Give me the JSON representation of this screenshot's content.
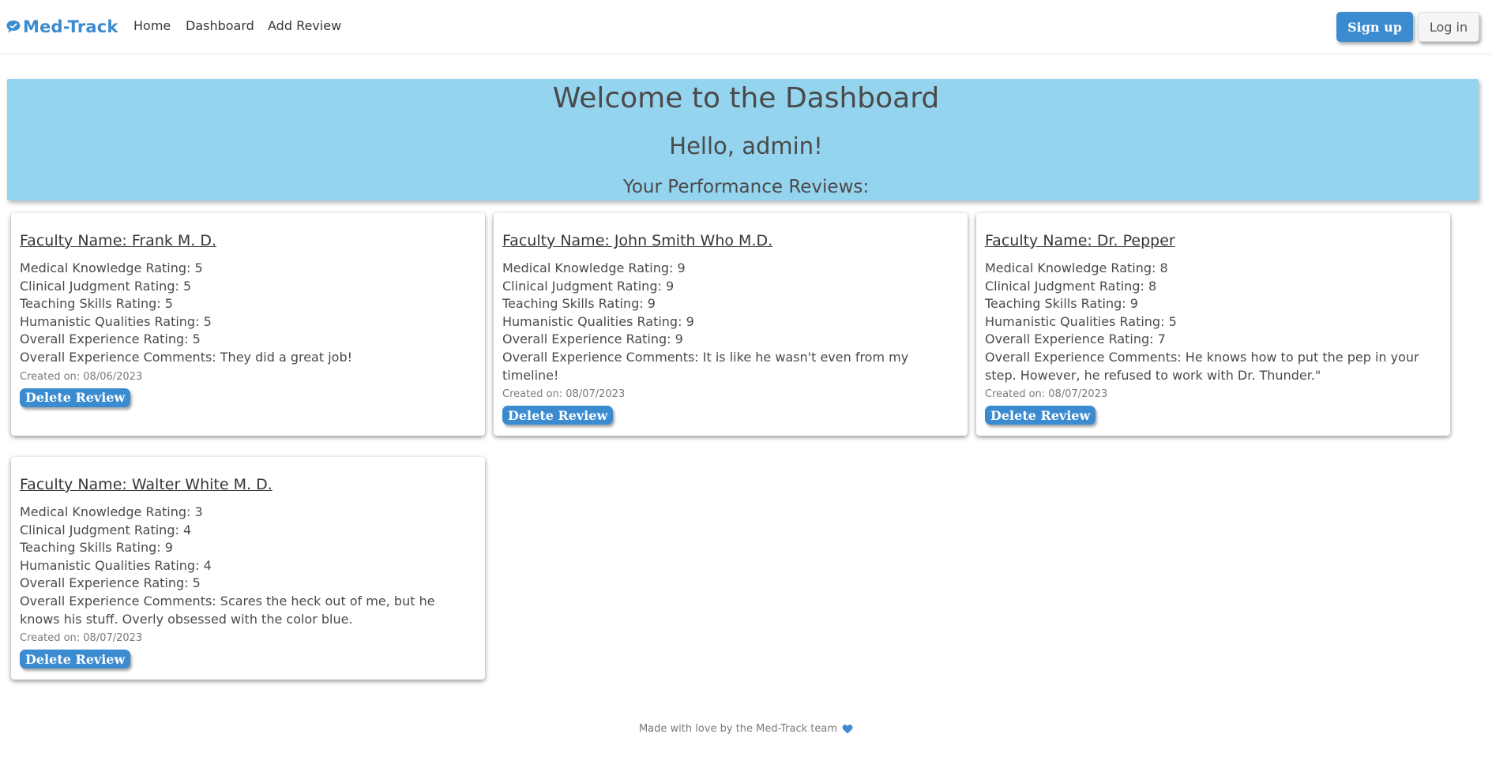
{
  "nav": {
    "brand": "Med-Track",
    "links": [
      "Home",
      "Dashboard",
      "Add Review"
    ],
    "signup_label": "Sign up",
    "login_label": "Log in",
    "brand_color": "#3b8bd0"
  },
  "hero": {
    "title": "Welcome to the Dashboard",
    "greeting": "Hello, admin!",
    "subtitle": "Your Performance Reviews:",
    "background": "#95d4ef"
  },
  "reviews": [
    {
      "faculty": "Faculty Name: Frank M. D.",
      "medical_knowledge": "Medical Knowledge Rating: 5",
      "clinical_judgment": "Clinical Judgment Rating: 5",
      "teaching_skills": "Teaching Skills Rating: 5",
      "humanistic_qualities": "Humanistic Qualities Rating: 5",
      "overall_rating": "Overall Experience Rating: 5",
      "comments": "Overall Experience Comments: They did a great job!",
      "created": "Created on: 08/06/2023",
      "delete_label": "Delete Review"
    },
    {
      "faculty": "Faculty Name: John Smith Who M.D.",
      "medical_knowledge": "Medical Knowledge Rating: 9",
      "clinical_judgment": "Clinical Judgment Rating: 9",
      "teaching_skills": "Teaching Skills Rating: 9",
      "humanistic_qualities": "Humanistic Qualities Rating: 9",
      "overall_rating": "Overall Experience Rating: 9",
      "comments": "Overall Experience Comments: It is like he wasn't even from my timeline!",
      "created": "Created on: 08/07/2023",
      "delete_label": "Delete Review"
    },
    {
      "faculty": "Faculty Name: Dr. Pepper",
      "medical_knowledge": "Medical Knowledge Rating: 8",
      "clinical_judgment": "Clinical Judgment Rating: 8",
      "teaching_skills": "Teaching Skills Rating: 9",
      "humanistic_qualities": "Humanistic Qualities Rating: 5",
      "overall_rating": "Overall Experience Rating: 7",
      "comments": "Overall Experience Comments: He knows how to put the pep in your step. However, he refused to work with Dr. Thunder.\"",
      "created": "Created on: 08/07/2023",
      "delete_label": "Delete Review"
    },
    {
      "faculty": "Faculty Name: Walter White M. D.",
      "medical_knowledge": "Medical Knowledge Rating: 3",
      "clinical_judgment": "Clinical Judgment Rating: 4",
      "teaching_skills": "Teaching Skills Rating: 9",
      "humanistic_qualities": "Humanistic Qualities Rating: 4",
      "overall_rating": "Overall Experience Rating: 5",
      "comments": "Overall Experience Comments: Scares the heck out of me, but he knows his stuff. Overly obsessed with the color blue.",
      "created": "Created on: 08/07/2023",
      "delete_label": "Delete Review"
    }
  ],
  "footer": {
    "text": "Made with love by the Med-Track team",
    "icon": "heart-icon"
  }
}
